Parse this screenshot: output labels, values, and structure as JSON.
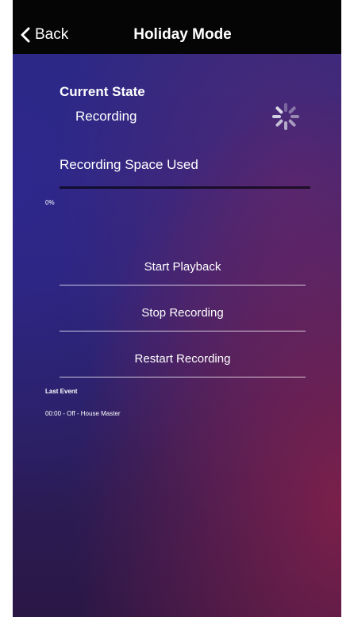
{
  "nav": {
    "back_label": "Back",
    "title": "Holiday Mode"
  },
  "state": {
    "label": "Current State",
    "value": "Recording"
  },
  "recording_space": {
    "label": "Recording Space Used",
    "percent_text": "0%",
    "percent": 0
  },
  "actions": [
    {
      "label": "Start Playback"
    },
    {
      "label": "Stop Recording"
    },
    {
      "label": "Restart Recording"
    }
  ],
  "last_event": {
    "title": "Last Event",
    "text": "00:00 - Off - House Master"
  },
  "icons": {
    "back": "chevron-left-icon",
    "status": "loading-spinner-icon"
  },
  "colors": {
    "nav_bar": "#050505",
    "text": "#ffffff",
    "bg_top": "#272b7e",
    "bg_accent": "#872048"
  }
}
